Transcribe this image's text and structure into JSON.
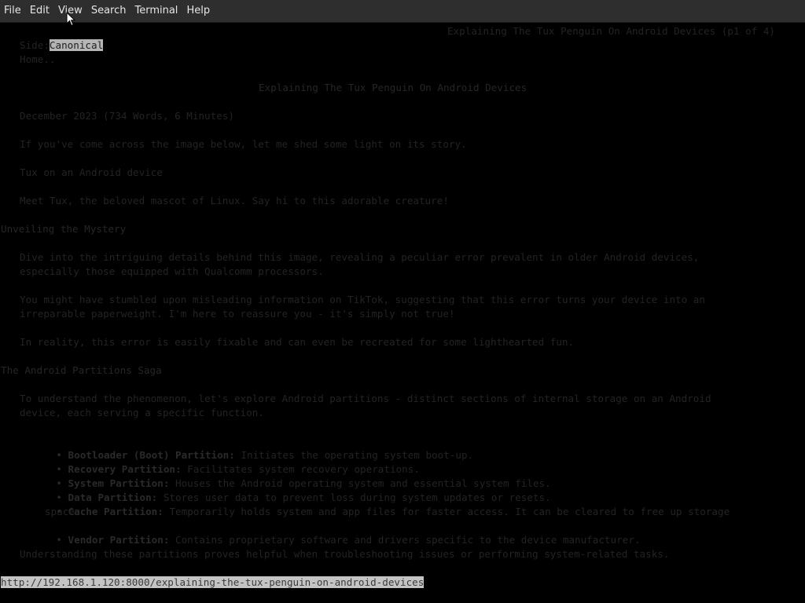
{
  "menu": {
    "items": [
      "File",
      "Edit",
      "View",
      "Search",
      "Terminal",
      "Help"
    ]
  },
  "page": {
    "header_right": "Explaining The Tux Penguin On Android Devices (p1 of 4)",
    "side_prefix": "Side:",
    "side_selected": "Canonical",
    "home_link": "Home..",
    "title": "Explaining The Tux Penguin On Android Devices",
    "meta": "December 2023 (734 Words, 6 Minutes)",
    "intro": "If you've come across the image below, let me shed some light on its story.",
    "image_alt": "Tux on an Android device",
    "meet": "Meet Tux, the beloved mascot of Linux. Say hi to this adorable creature!",
    "section1_heading": "Unveiling the Mystery",
    "s1_p1_l1": "Dive into the intriguing details behind this image, revealing a peculiar error prevalent in older Android devices,",
    "s1_p1_l2": "especially those equipped with Qualcomm processors.",
    "s1_p2_l1": "You might have stumbled upon misleading information on TikTok, suggesting that this error turns your device into an",
    "s1_p2_l2": "irreparable paperweight. I'm here to reassure you - it's simply not true!",
    "s1_p3": "In reality, this error is easily fixable and can even be recreated for some lighthearted fun.",
    "section2_heading": "The Android Partitions Saga",
    "s2_p1_l1": "To understand the phenomenon, let's explore Android partitions - distinct sections of internal storage on an Android",
    "s2_p1_l2": "device, each serving a specific function.",
    "bullets": [
      {
        "label": "Bootloader (Boot) Partition:",
        "text": " Initiates the operating system boot-up."
      },
      {
        "label": "Recovery Partition:",
        "text": " Facilitates system recovery operations."
      },
      {
        "label": "System Partition:",
        "text": " Houses the Android operating system and essential system files."
      },
      {
        "label": "Data Partition:",
        "text": " Stores user data to prevent loss during system updates or resets."
      },
      {
        "label": "Cache Partition:",
        "text": " Temporarily holds system and app files for faster access. It can be cleared to free up storage"
      },
      {
        "label": "Vendor Partition:",
        "text": " Contains proprietary software and drivers specific to the device manufacturer."
      }
    ],
    "bullet_char": "•",
    "cache_cont": "space.",
    "closing": "Understanding these partitions proves helpful when troubleshooting issues or performing system-related tasks."
  },
  "status": {
    "url": "http://192.168.1.120:8000/explaining-the-tux-penguin-on-android-devices"
  },
  "icons": {
    "pointer": "mouse-pointer-icon"
  }
}
